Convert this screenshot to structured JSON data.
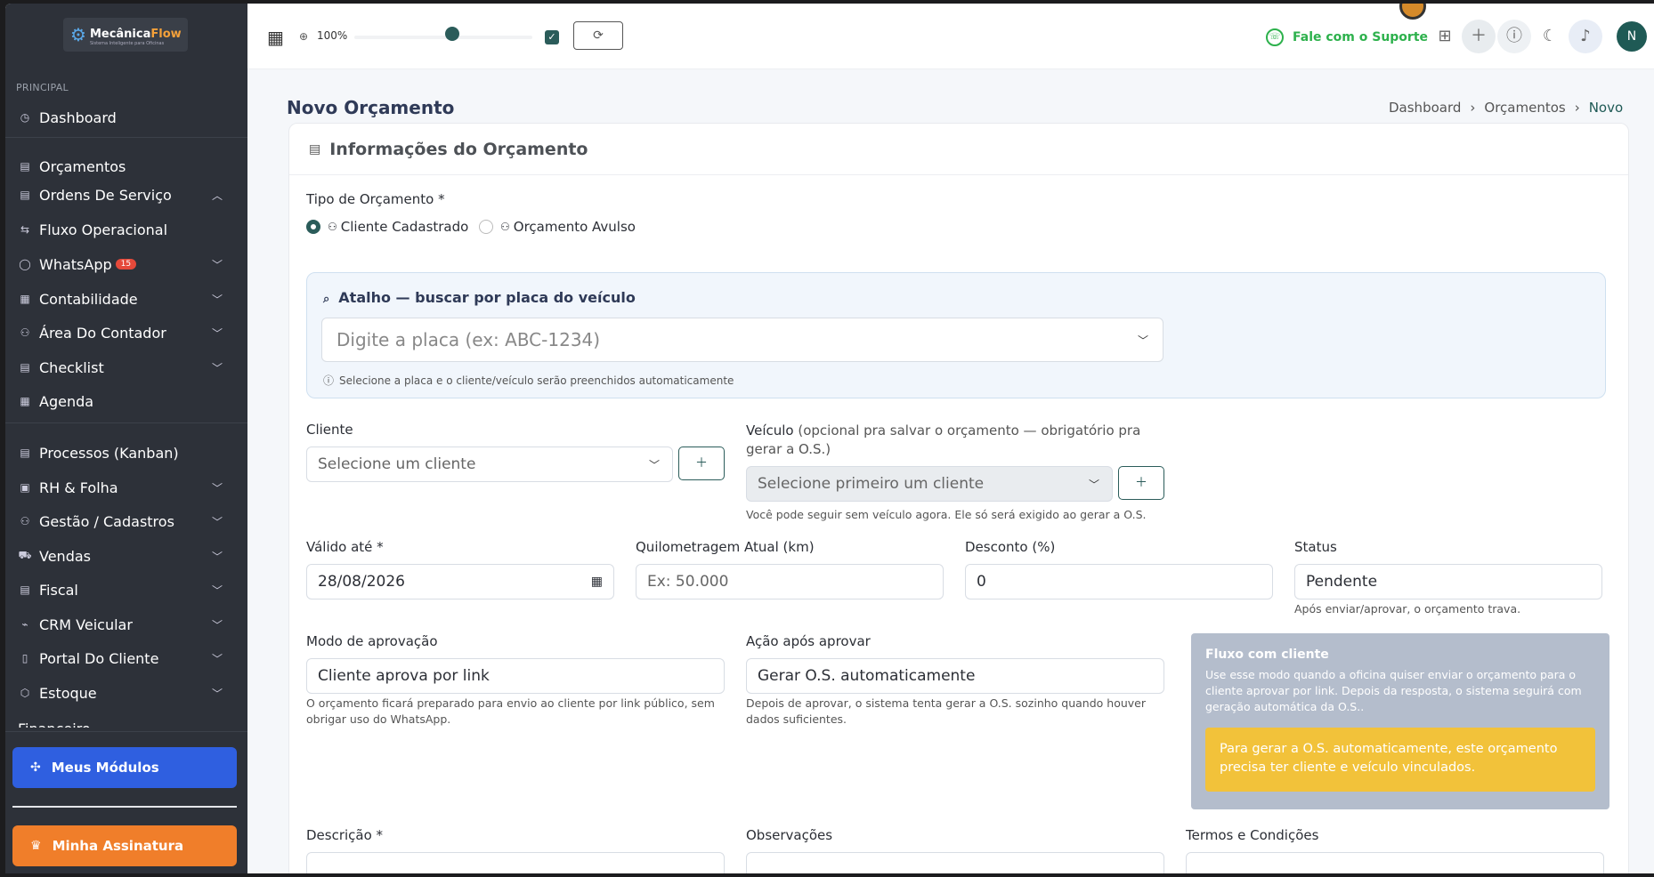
{
  "brand": {
    "name_a": "Mecânica",
    "name_b": "Flow",
    "tagline": "Sistema Inteligente para Oficinas"
  },
  "sidebar": {
    "section": "PRINCIPAL",
    "items": [
      {
        "label": "Dashboard"
      },
      {
        "label": "Orçamentos"
      },
      {
        "label": "Ordens De Serviço"
      },
      {
        "label": "Fluxo Operacional"
      },
      {
        "label": "WhatsApp",
        "badge": "15"
      },
      {
        "label": "Contabilidade"
      },
      {
        "label": "Área Do Contador"
      },
      {
        "label": "Checklist"
      },
      {
        "label": "Agenda"
      },
      {
        "label": "Processos (Kanban)"
      },
      {
        "label": "RH & Folha"
      },
      {
        "label": "Gestão / Cadastros"
      },
      {
        "label": "Vendas"
      },
      {
        "label": "Fiscal"
      },
      {
        "label": "CRM Veicular"
      },
      {
        "label": "Portal Do Cliente"
      },
      {
        "label": "Estoque"
      },
      {
        "label": "Financeiro"
      }
    ],
    "modules_button": "Meus Módulos",
    "subscription_button": "Minha Assinatura"
  },
  "topbar": {
    "zoom": "100%",
    "zoom_level": 0.55,
    "support": "Fale com o Suporte",
    "user_initial": "N"
  },
  "page": {
    "title": "Novo Orçamento",
    "breadcrumb": [
      "Dashboard",
      "Orçamentos",
      "Novo"
    ],
    "card_title": "Informações do Orçamento"
  },
  "form": {
    "type_label": "Tipo de Orçamento *",
    "type_options": [
      "Cliente Cadastrado",
      "Orçamento Avulso"
    ],
    "shortcut_title": "Atalho — buscar por placa do veículo",
    "shortcut_placeholder": "Digite a placa (ex: ABC-1234)",
    "shortcut_help": "Selecione a placa e o cliente/veículo serão preenchidos automaticamente",
    "client_label": "Cliente",
    "client_placeholder": "Selecione um cliente",
    "vehicle_label": "Veículo",
    "vehicle_note": "(opcional pra salvar o orçamento — obrigatório pra gerar",
    "vehicle_note2": "a O.S.)",
    "vehicle_placeholder": "Selecione primeiro um cliente",
    "vehicle_help": "Você pode seguir sem veículo agora. Ele só será exigido ao gerar a O.S.",
    "valid_label": "Válido até *",
    "valid_value": "28/08/2026",
    "km_label": "Quilometragem Atual (km)",
    "km_placeholder": "Ex: 50.000",
    "discount_label": "Desconto (%)",
    "discount_value": "0",
    "status_label": "Status",
    "status_value": "Pendente",
    "status_help": "Após enviar/aprovar, o orçamento trava.",
    "approval_label": "Modo de aprovação",
    "approval_value": "Cliente aprova por link",
    "approval_help": "O orçamento ficará preparado para envio ao cliente por link público, sem obrigar uso do WhatsApp.",
    "after_label": "Ação após aprovar",
    "after_value": "Gerar O.S. automaticamente",
    "after_help": "Depois de aprovar, o sistema tenta gerar a O.S. sozinho quando houver dados suficientes.",
    "flow_title": "Fluxo com cliente",
    "flow_text": "Use esse modo quando a oficina quiser enviar o orçamento para o cliente aprovar por link. Depois da resposta, o sistema seguirá com geração automática da O.S..",
    "flow_warning": "Para gerar a O.S. automaticamente, este orçamento precisa ter cliente e veículo vinculados.",
    "description_label": "Descrição *",
    "observations_label": "Observações",
    "terms_label": "Termos e Condições"
  }
}
